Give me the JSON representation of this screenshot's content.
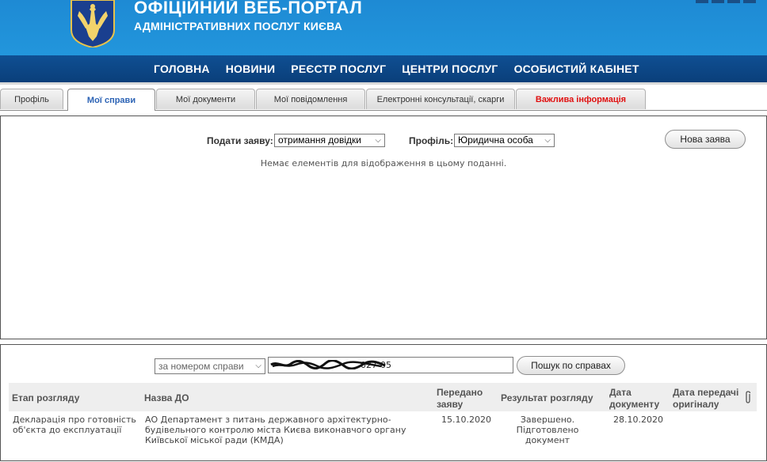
{
  "header": {
    "title": "ОФІЦІЙНИЙ ВЕБ-ПОРТАЛ",
    "subtitle": "АДМІНІСТРАТИВНИХ ПОСЛУГ КИЄВА",
    "logo_icon": "kyiv-coat-of-arms-icon",
    "colors": {
      "header_bg": "#1e8ad4",
      "nav_bg": "#0f4f93"
    }
  },
  "nav": {
    "items": [
      {
        "label": "ГОЛОВНА"
      },
      {
        "label": "НОВИНИ"
      },
      {
        "label": "РЕЄСТР ПОСЛУГ"
      },
      {
        "label": "ЦЕНТРИ ПОСЛУГ"
      },
      {
        "label": "ОСОБИСТИЙ КАБІНЕТ"
      }
    ]
  },
  "tabs": [
    {
      "label": "Профіль"
    },
    {
      "label": "Мої справи",
      "active": true
    },
    {
      "label": "Мої документи"
    },
    {
      "label": "Мої повідомлення"
    },
    {
      "label": "Електронні консультації, скарги"
    },
    {
      "label": "Важлива інформація",
      "color": "#e01010"
    }
  ],
  "applications": {
    "submit_label": "Подати заяву:",
    "submit_value": "отримання довідки",
    "profile_label": "Профіль:",
    "profile_value": "Юридична особа",
    "new_button": "Нова заява",
    "empty_message": "Немає елементів для відображення в цьому поданні."
  },
  "cases": {
    "search_by_value": "за номером справи",
    "search_value": "027-05",
    "search_button": "Пошук по справах",
    "columns": {
      "stage": "Етап розгляду",
      "org": "Назва ДО",
      "submitted": "Передано заяву",
      "result": "Результат розгляду",
      "doc_date": "Дата документу",
      "orig_date": "Дата передачі оригіналу"
    },
    "attachment_icon": "paperclip-icon",
    "rows": [
      {
        "stage": "Декларація про готовність об'єкта до експлуатації",
        "org": "АО Департамент з питань державного архітектурно-будівельного контролю міста Києва виконавчого органу Київської міської ради (КМДА)",
        "submitted": "15.10.2020",
        "result": "Завершено. Підготовлено документ",
        "doc_date": "28.10.2020",
        "orig_date": ""
      }
    ]
  }
}
